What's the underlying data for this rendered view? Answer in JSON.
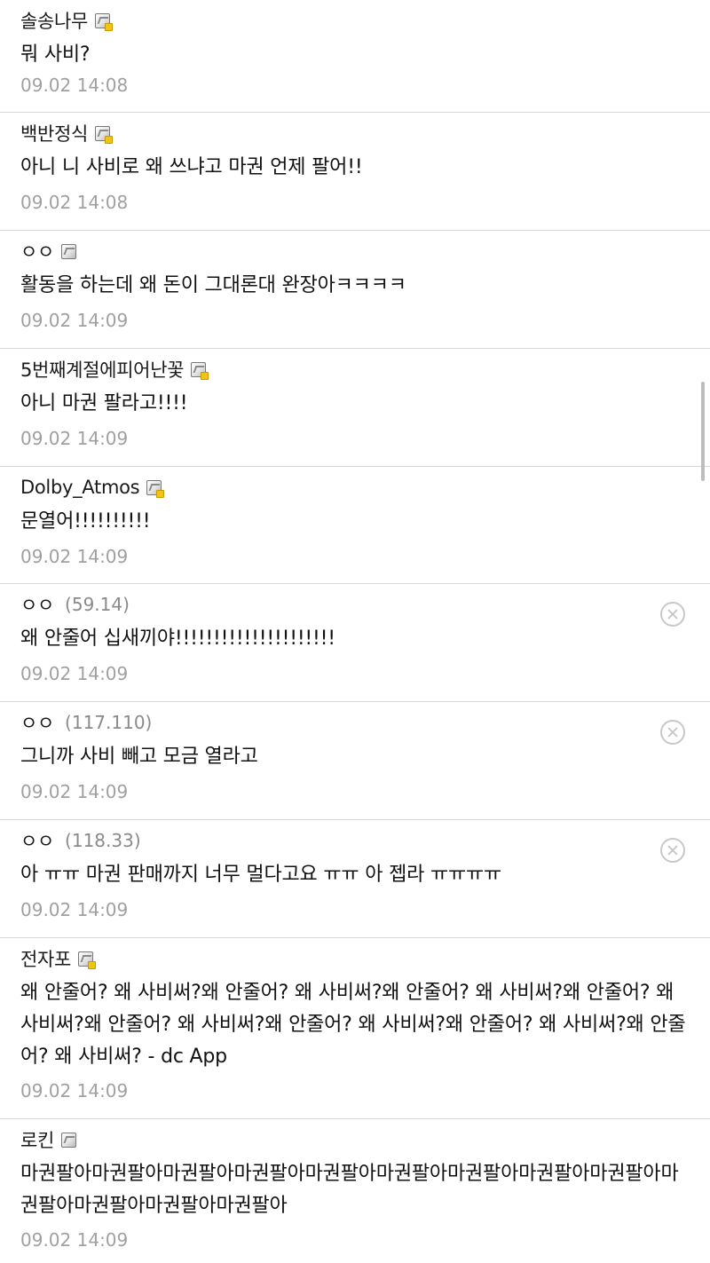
{
  "comments": [
    {
      "nickname": "솔송나무",
      "text": "뭐 사비?",
      "time": "09.02 14:08",
      "badge_icon": "fixed-nick-icon"
    },
    {
      "nickname": "백반정식",
      "text": "아니 니 사비로 왜 쓰냐고 마권 언제 팔어!!",
      "time": "09.02 14:08",
      "badge_icon": "fixed-nick-icon"
    },
    {
      "nickname": "ㅇㅇ",
      "text": "활동을 하는데 왜 돈이 그대론대 완장아ㅋㅋㅋㅋ",
      "time": "09.02 14:09",
      "badge_icon": "nick-icon"
    },
    {
      "nickname": "5번째계절에피어난꽃",
      "text": "아니 마권 팔라고!!!!",
      "time": "09.02 14:09",
      "badge_icon": "fixed-nick-icon"
    },
    {
      "nickname": "Dolby_Atmos",
      "text": "문열어!!!!!!!!!!",
      "time": "09.02 14:09",
      "badge_icon": "fixed-nick-icon"
    },
    {
      "nickname": "ㅇㅇ",
      "ip": "(59.14)",
      "text": "왜 안줄어 십새끼야!!!!!!!!!!!!!!!!!!!!!",
      "time": "09.02 14:09",
      "delete_icon": "close-circle-icon"
    },
    {
      "nickname": "ㅇㅇ",
      "ip": "(117.110)",
      "text": "그니까 사비 빼고 모금 열라고",
      "time": "09.02 14:09",
      "delete_icon": "close-circle-icon"
    },
    {
      "nickname": "ㅇㅇ",
      "ip": "(118.33)",
      "text": "아 ㅠㅠ 마권 판매까지 너무 멀다고요 ㅠㅠ 아 젭라 ㅠㅠㅠㅠ",
      "time": "09.02 14:09",
      "delete_icon": "close-circle-icon"
    },
    {
      "nickname": "전자포",
      "text": "왜 안줄어? 왜 사비써?왜 안줄어? 왜 사비써?왜 안줄어? 왜 사비써?왜 안줄어? 왜 사비써?왜 안줄어? 왜 사비써?왜 안줄어? 왜 사비써?왜 안줄어? 왜 사비써?왜 안줄어? 왜 사비써? - dc App",
      "time": "09.02 14:09",
      "badge_icon": "fixed-nick-icon"
    },
    {
      "nickname": "로킨",
      "text": "마권팔아마권팔아마권팔아마권팔아마권팔아마권팔아마권팔아마권팔아마권팔아마권팔아마권팔아마권팔아마권팔아",
      "time": "09.02 14:09",
      "badge_icon": "nick-icon"
    }
  ]
}
